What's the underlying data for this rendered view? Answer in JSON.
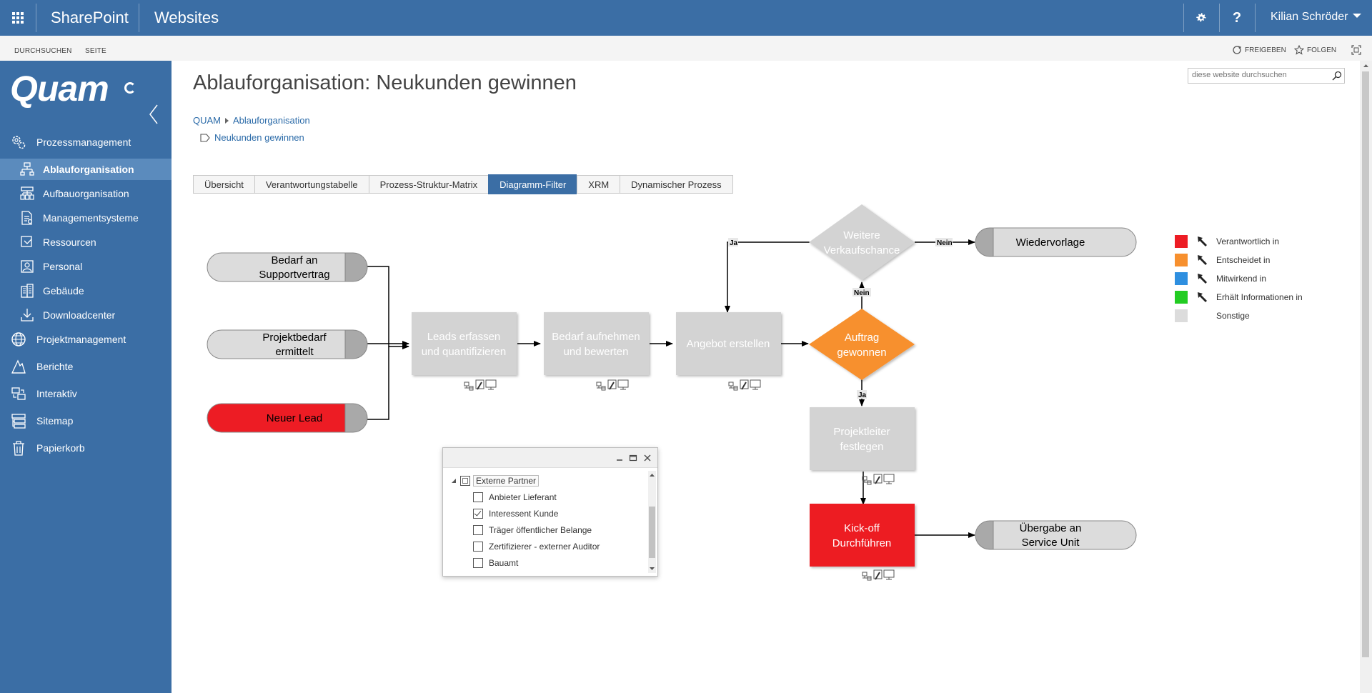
{
  "suite": {
    "brand": "SharePoint",
    "site": "Websites",
    "user": "Kilian Schröder"
  },
  "ribbon": {
    "tab_browse": "DURCHSUCHEN",
    "tab_page": "SEITE",
    "share": "FREIGEBEN",
    "follow": "FOLGEN"
  },
  "sidebar": {
    "logo": "Quam",
    "items": [
      {
        "label": "Prozessmanagement",
        "icon": "gears-icon"
      },
      {
        "label": "Ablauforganisation",
        "icon": "process-flow-icon"
      },
      {
        "label": "Aufbauorganisation",
        "icon": "org-chart-icon"
      },
      {
        "label": "Managementsysteme",
        "icon": "document-cog-icon"
      },
      {
        "label": "Ressourcen",
        "icon": "resources-icon"
      },
      {
        "label": "Personal",
        "icon": "person-icon"
      },
      {
        "label": "Gebäude",
        "icon": "building-icon"
      },
      {
        "label": "Downloadcenter",
        "icon": "download-icon"
      },
      {
        "label": "Projektmanagement",
        "icon": "globe-icon"
      },
      {
        "label": "Berichte",
        "icon": "report-icon"
      },
      {
        "label": "Interaktiv",
        "icon": "interactive-icon"
      },
      {
        "label": "Sitemap",
        "icon": "sitemap-icon"
      },
      {
        "label": "Papierkorb",
        "icon": "trash-icon"
      }
    ]
  },
  "page": {
    "title": "Ablauforganisation: Neukunden gewinnen",
    "search_placeholder": "diese website durchsuchen",
    "breadcrumb": [
      "QUAM",
      "Ablauforganisation"
    ],
    "sub_crumb": "Neukunden gewinnen"
  },
  "tabs": [
    "Übersicht",
    "Verantwortungstabelle",
    "Prozess-Struktur-Matrix",
    "Diagramm-Filter",
    "XRM",
    "Dynamischer Prozess"
  ],
  "diagram": {
    "start1": [
      "Bedarf an",
      "Supportvertrag"
    ],
    "start2": [
      "Projektbedarf",
      "ermittelt"
    ],
    "start3": [
      "Neuer Lead"
    ],
    "step1": [
      "Leads erfassen",
      "und quantifizieren"
    ],
    "step2": [
      "Bedarf aufnehmen",
      "und bewerten"
    ],
    "step3": [
      "Angebot erstellen"
    ],
    "decision1": [
      "Auftrag",
      "gewonnen"
    ],
    "decision2": [
      "Weitere",
      "Verkaufschance"
    ],
    "end1": [
      "Wiedervorlage"
    ],
    "step4": [
      "Projektleiter",
      "festlegen"
    ],
    "step5": [
      "Kick-off",
      "Durchführen"
    ],
    "end2": [
      "Übergabe an",
      "Service Unit"
    ],
    "label_ja": "Ja",
    "label_nein": "Nein",
    "colors": {
      "red": "#ed1c24",
      "orange": "#f7902e",
      "gray": "#d3d3d3",
      "terminal": "#dcdcdc"
    }
  },
  "legend": [
    {
      "label": "Verantwortlich in",
      "color": "#ed1c24"
    },
    {
      "label": "Entscheidet in",
      "color": "#f7902e"
    },
    {
      "label": "Mitwirkend in",
      "color": "#2e8fe0"
    },
    {
      "label": "Erhält Informationen in",
      "color": "#22cc22"
    },
    {
      "label": "Sonstige",
      "color": "#dcdcdc"
    }
  ],
  "filter": {
    "group": "Externe Partner",
    "items": [
      {
        "label": "Anbieter Lieferant",
        "checked": false
      },
      {
        "label": "Interessent Kunde",
        "checked": true
      },
      {
        "label": "Träger öffentlicher Belange",
        "checked": false
      },
      {
        "label": "Zertifizierer - externer Auditor",
        "checked": false
      },
      {
        "label": "Bauamt",
        "checked": false
      }
    ]
  }
}
